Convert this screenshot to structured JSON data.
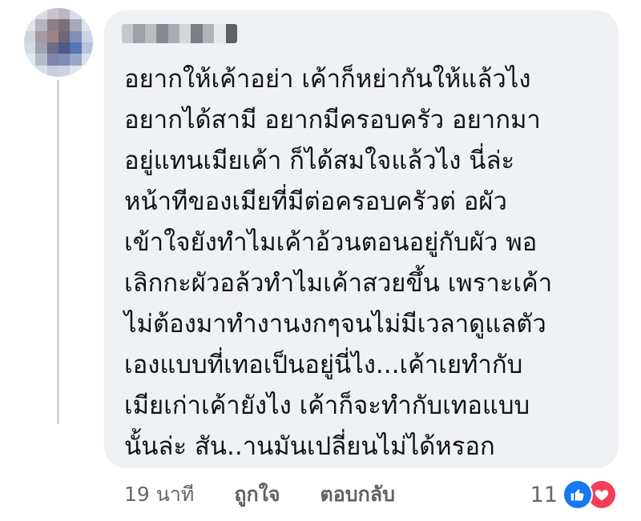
{
  "comment": {
    "text": "อยากให้เค้าอย่า เค้าก็หย่ากันให้แล้วไง\nอยากได้สามี อยากมีครอบครัว อยากมา\nอยู่แทนเมียเค้า ก็ได้สมใจแล้วไง นี่ล่ะ\nหน้าทีของเมียที่มีต่อครอบครัวต่ อผัว\nเข้าใจยังทำไมเค้าอ้วนตอนอยู่กับผัว พอ\nเลิกกะผัวอล้วทำไมเค้าสวยขึ้น เพราะเค้า\nไม่ต้องมาทำงานงกๆจนไม่มีเวลาดูแลตัว\nเองแบบที่เทอเป็นอยู่นี่ไง...เค้าเยทำกับ\nเมียเก่าเค้ายังไง เค้าก็จะทำกับเทอแบบ\nนั้นล่ะ สัน..านมันเปลี่ยนไม่ได้หรอก"
  },
  "footer": {
    "timestamp": "19 นาที",
    "like_label": "ถูกใจ",
    "reply_label": "ตอบกลับ"
  },
  "reactions": {
    "count": "11",
    "icons": [
      "like-icon",
      "love-icon"
    ],
    "like_color": "#1877f2",
    "love_color": "#f33e58"
  },
  "colors": {
    "bubble": "#eff1f4",
    "text": "#111318",
    "meta": "#65676b"
  }
}
